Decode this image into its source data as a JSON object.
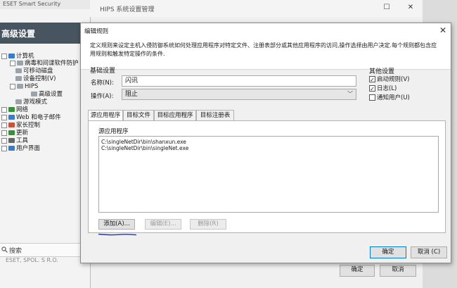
{
  "eset": {
    "title": "ESET Smart Security",
    "header": "高级设置",
    "search_placeholder": "搜索",
    "footer": "ESET, SPOL. S R.O.",
    "tree": [
      {
        "label": "计算机",
        "icon": "computer-icon"
      },
      {
        "label": "病毒和间谍软件防护",
        "icon": "shield-icon"
      },
      {
        "label": "可移动磁盘",
        "icon": "disk-icon"
      },
      {
        "label": "设备控制(V)",
        "icon": "device-icon"
      },
      {
        "label": "HIPS",
        "icon": "hips-icon"
      },
      {
        "label": "高级设置",
        "icon": "settings-icon"
      },
      {
        "label": "游戏模式",
        "icon": "game-icon"
      },
      {
        "label": "网络",
        "icon": "network-icon"
      },
      {
        "label": "Web 和电子邮件",
        "icon": "web-icon"
      },
      {
        "label": "家长控制",
        "icon": "parental-icon"
      },
      {
        "label": "更新",
        "icon": "update-icon"
      },
      {
        "label": "工具",
        "icon": "tools-icon"
      },
      {
        "label": "用户界面",
        "icon": "ui-icon"
      }
    ]
  },
  "hips": {
    "title": "HIPS 系统设置管理",
    "ok": "确定",
    "cancel": "取消"
  },
  "edit": {
    "title": "编辑规则",
    "description": "定义规则来设定主机入侵防御系统如何处理应用程序对特定文件、注册表部分或其他应用程序的访问,操作选择由用户决定.每个规则都包含应用规则和触发特定操作的条件.",
    "basic_group": "基础设置",
    "name_label": "名称(N):",
    "name_value": "闪讯",
    "action_label": "操作(A):",
    "action_value": "阻止",
    "other_group": "其他设置",
    "checkboxes": [
      {
        "label": "启动规则(V)",
        "checked": true
      },
      {
        "label": "日志(L)",
        "checked": true
      },
      {
        "label": "通知用户(U)",
        "checked": false
      }
    ],
    "tabs": [
      "源应用程序",
      "目标文件",
      "目标应用程序",
      "目标注册表"
    ],
    "active_tab": 0,
    "source_group": "源应用程序",
    "source_list": [
      "C:\\singleNetDir\\bin\\shanxun.exe",
      "C:\\singleNetDir\\bin\\singleNet.exe"
    ],
    "add": "添加(A)...",
    "edit": "编辑(E)...",
    "delete": "删除(R)",
    "ok": "确定",
    "cancel": "取消 (C)"
  },
  "colors": {
    "header_bg": "#465560",
    "annotation": "#1f3aa8",
    "accent": "#0078d7"
  }
}
